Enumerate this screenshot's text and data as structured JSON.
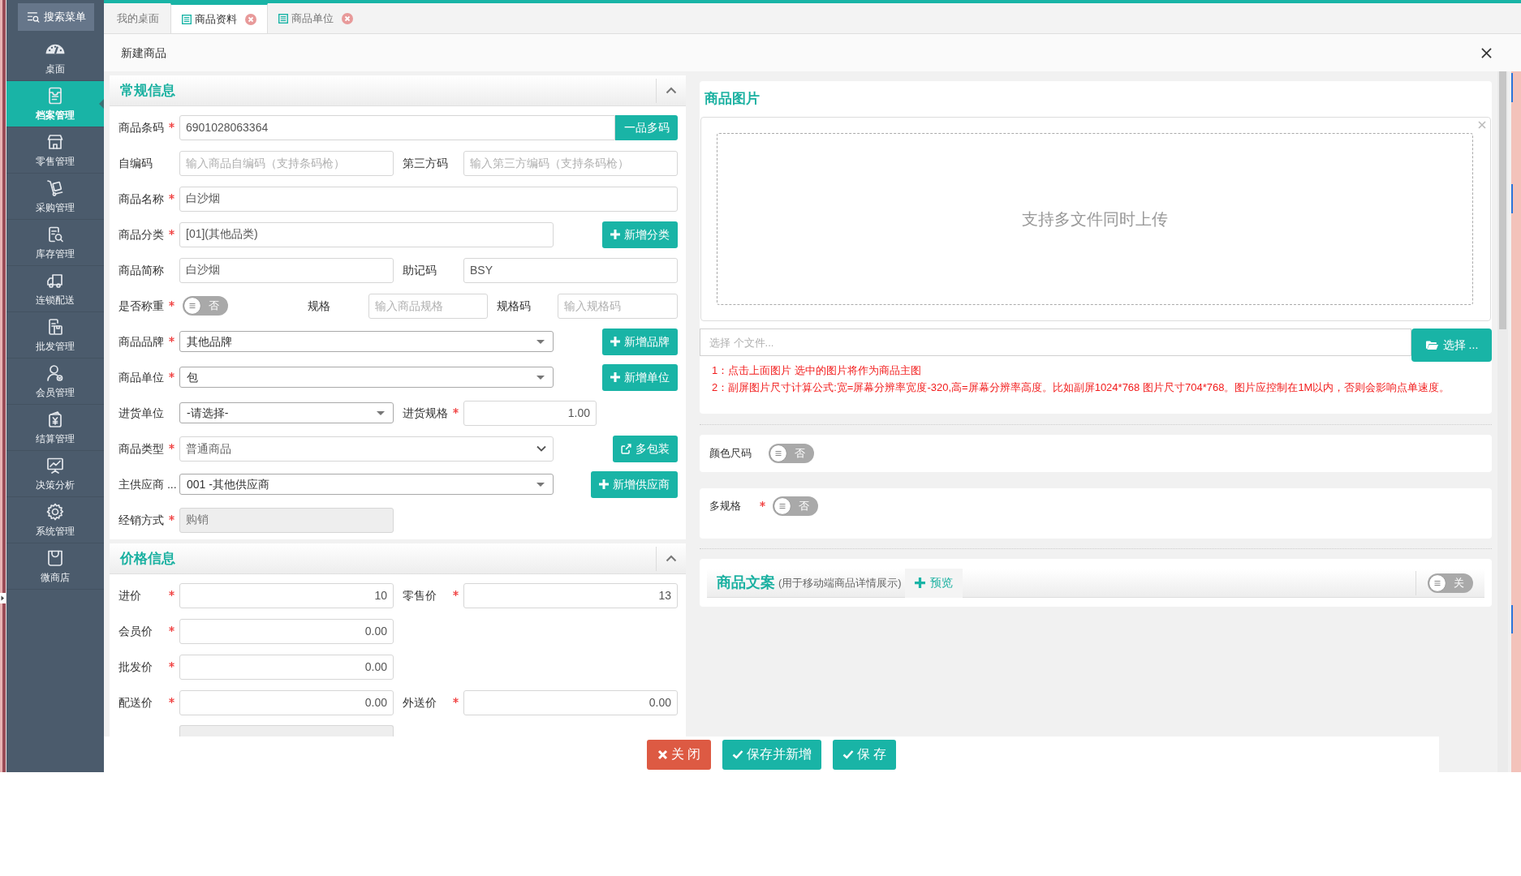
{
  "sidebar": {
    "search_button": "搜索菜单",
    "items": [
      {
        "label": "桌面",
        "selected": false
      },
      {
        "label": "档案管理",
        "selected": true
      },
      {
        "label": "零售管理",
        "selected": false
      },
      {
        "label": "采购管理",
        "selected": false
      },
      {
        "label": "库存管理",
        "selected": false
      },
      {
        "label": "连锁配送",
        "selected": false
      },
      {
        "label": "批发管理",
        "selected": false
      },
      {
        "label": "会员管理",
        "selected": false
      },
      {
        "label": "结算管理",
        "selected": false
      },
      {
        "label": "决策分析",
        "selected": false
      },
      {
        "label": "系统管理",
        "selected": false
      },
      {
        "label": "微商店",
        "selected": false
      }
    ]
  },
  "tabs": [
    {
      "label": "我的桌面",
      "kind": "home",
      "selected": false
    },
    {
      "label": "商品资料",
      "kind": "page",
      "selected": true
    },
    {
      "label": "商品单位",
      "kind": "page",
      "selected": false
    }
  ],
  "page": {
    "title": "新建商品"
  },
  "general": {
    "title": "常规信息",
    "expanded": true,
    "rows": [
      {
        "kind": "attached",
        "fields": [
          {
            "label": "商品条码",
            "required": true,
            "kind": "text",
            "value": "6901028063364"
          }
        ],
        "button": {
          "label": "一品多码",
          "kind": "plain"
        }
      },
      {
        "kind": "pair",
        "fields": [
          {
            "label": "自编码",
            "required": false,
            "kind": "text",
            "placeholder": "输入商品自编码（支持条码枪）"
          },
          {
            "label": "第三方码",
            "required": false,
            "kind": "text",
            "placeholder": "输入第三方编码（支持条码枪）"
          }
        ]
      },
      {
        "kind": "wide",
        "fields": [
          {
            "label": "商品名称",
            "required": true,
            "kind": "text",
            "value": "白沙烟"
          }
        ]
      },
      {
        "kind": "with_button",
        "fields": [
          {
            "label": "商品分类",
            "required": true,
            "kind": "text",
            "value": "[01](其他品类)"
          }
        ],
        "button": {
          "label": "新增分类",
          "kind": "add"
        }
      },
      {
        "kind": "pair",
        "fields": [
          {
            "label": "商品简称",
            "required": false,
            "kind": "text",
            "value": "白沙烟"
          },
          {
            "label": "助记码",
            "required": false,
            "kind": "text",
            "value": "BSY"
          }
        ]
      },
      {
        "kind": "specs",
        "fields": [
          {
            "label": "是否称重",
            "required": true,
            "kind": "toggle",
            "on": false,
            "value": "否"
          },
          {
            "label": "规格",
            "required": false,
            "kind": "text",
            "placeholder": "输入商品规格"
          },
          {
            "label": "规格码",
            "required": false,
            "kind": "text",
            "placeholder": "输入规格码"
          }
        ]
      },
      {
        "kind": "with_button",
        "fields": [
          {
            "label": "商品品牌",
            "required": true,
            "kind": "select",
            "value": "其他品牌"
          }
        ],
        "button": {
          "label": "新增品牌",
          "kind": "add"
        }
      },
      {
        "kind": "with_button",
        "fields": [
          {
            "label": "商品单位",
            "required": true,
            "kind": "select",
            "value": "包"
          }
        ],
        "button": {
          "label": "新增单位",
          "kind": "add"
        }
      },
      {
        "kind": "pair_narrow",
        "fields": [
          {
            "label": "进货单位",
            "required": false,
            "kind": "select",
            "value": "-请选择-"
          },
          {
            "label": "进货规格",
            "required": true,
            "kind": "number",
            "value": "1.00"
          }
        ]
      },
      {
        "kind": "with_button",
        "fields": [
          {
            "label": "商品类型",
            "required": true,
            "kind": "native_select",
            "value": "普通商品"
          }
        ],
        "button": {
          "label": "多包装",
          "kind": "link"
        }
      },
      {
        "kind": "with_button",
        "fields": [
          {
            "label": "主供应商 ...",
            "required": false,
            "kind": "select",
            "value": "001 -其他供应商"
          }
        ],
        "button": {
          "label": "新增供应商",
          "kind": "add"
        }
      },
      {
        "kind": "single",
        "fields": [
          {
            "label": "经销方式",
            "required": true,
            "kind": "disabled",
            "value": "购销"
          }
        ]
      }
    ]
  },
  "pricing": {
    "title": "价格信息",
    "expanded": true,
    "rows": [
      {
        "kind": "pair",
        "fields": [
          {
            "label": "进价",
            "required": true,
            "kind": "number",
            "value": "10"
          },
          {
            "label": "零售价",
            "required": true,
            "kind": "number",
            "value": "13"
          }
        ]
      },
      {
        "kind": "single",
        "fields": [
          {
            "label": "会员价",
            "required": true,
            "kind": "number",
            "value": "0.00"
          }
        ]
      },
      {
        "kind": "single",
        "fields": [
          {
            "label": "批发价",
            "required": true,
            "kind": "number",
            "value": "0.00"
          }
        ]
      },
      {
        "kind": "pair",
        "fields": [
          {
            "label": "配送价",
            "required": true,
            "kind": "number",
            "value": "0.00"
          },
          {
            "label": "外送价",
            "required": true,
            "kind": "number",
            "value": "0.00"
          }
        ]
      },
      {
        "kind": "cut"
      }
    ]
  },
  "images": {
    "title": "商品图片",
    "dropzone": "支持多文件同时上传",
    "file_input": {
      "placeholder": "选择 个文件..."
    },
    "browse_button": "选择 ...",
    "notes": [
      "1：点击上面图片 选中的图片将作为商品主图",
      "2：副屏图片尺寸计算公式:宽=屏幕分辨率宽度-320,高=屏幕分辨率高度。比如副屏1024*768 图片尺寸704*768。图片应控制在1M以内，否则会影响点单速度。"
    ]
  },
  "color_size": {
    "label": "颜色尺码",
    "toggle": {
      "on": false,
      "value": "否"
    }
  },
  "multi_spec": {
    "label": "多规格",
    "required": true,
    "toggle": {
      "on": false,
      "value": "否"
    }
  },
  "copy": {
    "title": "商品文案",
    "note": "(用于移动端商品详情展示)",
    "preview_button": "预览",
    "toggle": {
      "on": false,
      "value": "关"
    }
  },
  "footer": {
    "buttons": [
      {
        "label": "关 闭",
        "kind": "cancel"
      },
      {
        "label": "保存并新增",
        "kind": "confirm"
      },
      {
        "label": "保 存",
        "kind": "confirm"
      }
    ]
  }
}
